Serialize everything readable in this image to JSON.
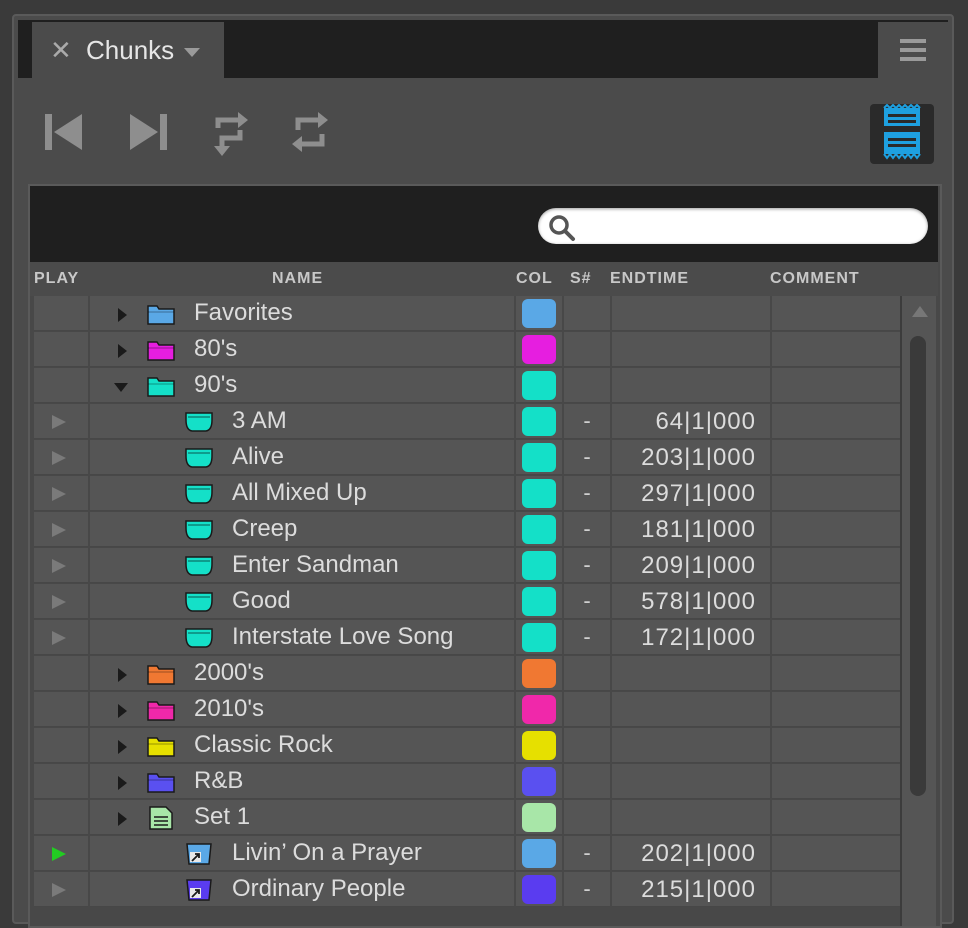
{
  "tab": {
    "title": "Chunks",
    "close_icon": "close-icon",
    "dropdown_icon": "chevron-down-icon"
  },
  "menu_icon": "hamburger-menu-icon",
  "toolbar": {
    "buttons": [
      "skip-previous-icon",
      "skip-next-icon",
      "loop-swap-icon",
      "loop-icon"
    ],
    "view_toggle_icon": "list-view-icon",
    "accent": "#1ea0e0"
  },
  "search": {
    "placeholder": "",
    "value": ""
  },
  "columns": {
    "play": "PLAY",
    "name": "NAME",
    "col": "COL",
    "snum": "S#",
    "endtime": "ENDTIME",
    "comment": "COMMENT"
  },
  "rows": [
    {
      "type": "folder",
      "name": "Favorites",
      "color": "#5aa8e6",
      "expanded": false
    },
    {
      "type": "folder",
      "name": "80's",
      "color": "#e61ee0",
      "expanded": false
    },
    {
      "type": "folder",
      "name": "90's",
      "color": "#14e0c8",
      "expanded": true
    },
    {
      "type": "chunk",
      "name": "3 AM",
      "color": "#14e0c8",
      "snum": "-",
      "endtime": "64|1|000",
      "playing": false
    },
    {
      "type": "chunk",
      "name": "Alive",
      "color": "#14e0c8",
      "snum": "-",
      "endtime": "203|1|000",
      "playing": false
    },
    {
      "type": "chunk",
      "name": "All Mixed Up",
      "color": "#14e0c8",
      "snum": "-",
      "endtime": "297|1|000",
      "playing": false
    },
    {
      "type": "chunk",
      "name": "Creep",
      "color": "#14e0c8",
      "snum": "-",
      "endtime": "181|1|000",
      "playing": false
    },
    {
      "type": "chunk",
      "name": "Enter Sandman",
      "color": "#14e0c8",
      "snum": "-",
      "endtime": "209|1|000",
      "playing": false
    },
    {
      "type": "chunk",
      "name": "Good",
      "color": "#14e0c8",
      "snum": "-",
      "endtime": "578|1|000",
      "playing": false
    },
    {
      "type": "chunk",
      "name": "Interstate Love Song",
      "color": "#14e0c8",
      "snum": "-",
      "endtime": "172|1|000",
      "playing": false
    },
    {
      "type": "folder",
      "name": "2000's",
      "color": "#f07832",
      "expanded": false
    },
    {
      "type": "folder",
      "name": "2010's",
      "color": "#f028aa",
      "expanded": false
    },
    {
      "type": "folder",
      "name": "Classic Rock",
      "color": "#e6e000",
      "expanded": false
    },
    {
      "type": "folder",
      "name": "R&B",
      "color": "#5a50f0",
      "expanded": false
    },
    {
      "type": "set",
      "name": "Set 1",
      "color": "#a8e6a8",
      "expanded": false
    },
    {
      "type": "link",
      "name": "Livin’ On a Prayer",
      "color": "#5aa8e6",
      "snum": "-",
      "endtime": "202|1|000",
      "playing": true
    },
    {
      "type": "link",
      "name": "Ordinary People",
      "color": "#5a3cf0",
      "snum": "-",
      "endtime": "215|1|000",
      "playing": false
    }
  ]
}
